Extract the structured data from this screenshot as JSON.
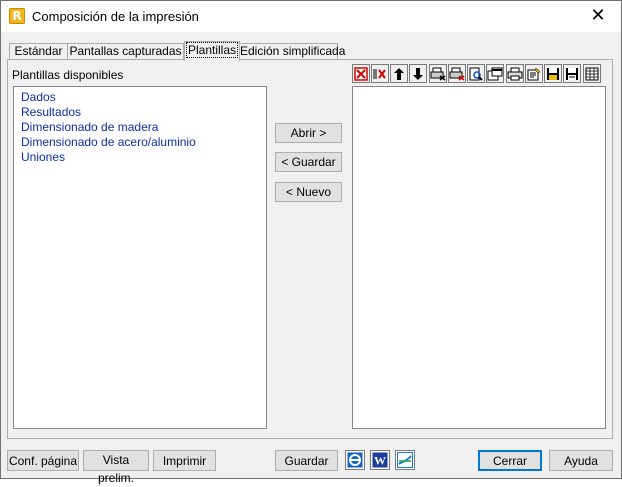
{
  "window": {
    "title": "Composición de la impresión",
    "close_glyph": "✕"
  },
  "tabs": [
    {
      "label": "Estándar",
      "active": false
    },
    {
      "label": "Pantallas capturadas",
      "active": false
    },
    {
      "label": "Plantillas",
      "active": true
    },
    {
      "label": "Edición simplificada",
      "active": false
    }
  ],
  "available": {
    "label": "Plantillas disponibles",
    "items": [
      "Dados",
      "Resultados",
      "Dimensionado de madera",
      "Dimensionado de acero/aluminio",
      "Uniones"
    ]
  },
  "middle_buttons": {
    "open": "Abrir >",
    "save": "< Guardar",
    "new": "< Nuevo"
  },
  "toolbar_icons": [
    "delete-red-x-icon",
    "delete-all-icon",
    "move-up-arrow-icon",
    "move-down-arrow-icon",
    "print-options-icon",
    "print-options-remove-icon",
    "page-preview-icon",
    "export-window-icon",
    "printer-icon",
    "edit-note-icon",
    "save-floppy-icon",
    "save-as-floppy-icon",
    "table-icon"
  ],
  "bottom": {
    "page_setup": "Conf. página",
    "preview": "Vista prelim.",
    "print": "Imprimir",
    "save": "Guardar",
    "close": "Cerrar",
    "help": "Ayuda",
    "icons": [
      "internet-explorer-icon",
      "word-icon",
      "chart-export-icon"
    ],
    "word_letter": "W"
  },
  "colors": {
    "accent": "#0078d7",
    "list_text": "#0b2ea8",
    "icon_red": "#d40000"
  }
}
